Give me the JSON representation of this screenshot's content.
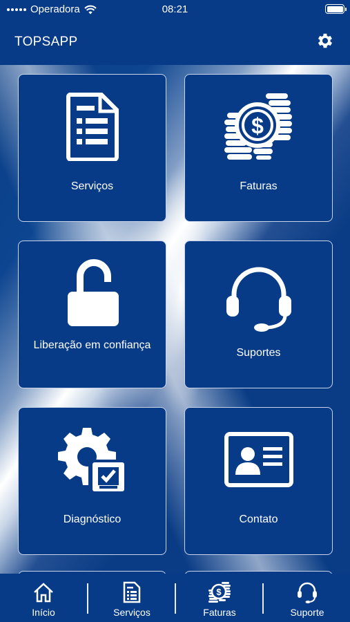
{
  "status": {
    "carrier": "Operadora",
    "time": "08:21"
  },
  "header": {
    "title": "TOPSAPP"
  },
  "tiles": [
    {
      "label": "Serviços",
      "icon": "document-list-icon"
    },
    {
      "label": "Faturas",
      "icon": "money-coins-icon"
    },
    {
      "label": "Liberação em confiança",
      "icon": "unlocked-padlock-icon"
    },
    {
      "label": "Suportes",
      "icon": "headset-icon"
    },
    {
      "label": "Diagnóstico",
      "icon": "gear-checklist-icon"
    },
    {
      "label": "Contato",
      "icon": "contact-card-icon"
    }
  ],
  "tabbar": [
    {
      "label": "Início",
      "icon": "home-icon"
    },
    {
      "label": "Serviços",
      "icon": "document-list-icon"
    },
    {
      "label": "Faturas",
      "icon": "money-coins-icon"
    },
    {
      "label": "Suporte",
      "icon": "headset-icon"
    }
  ],
  "colors": {
    "primary": "#073b87",
    "tile_border": "#c9d6ea",
    "text": "#ffffff"
  }
}
